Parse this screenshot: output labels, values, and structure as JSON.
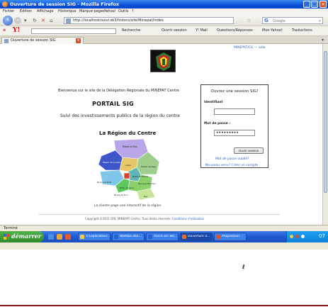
{
  "window": {
    "title": "Ouverture de session SIG - Mozilla Firefox",
    "minimize": "_",
    "maximize": "□",
    "close": "×"
  },
  "menu": [
    "Fichier",
    "Édition",
    "Affichage",
    "Historique",
    "Marque-pages",
    "Yahoo!",
    "Outils",
    "?"
  ],
  "nav": {
    "url": "http://localhost/suivi.sb3/htdocs/site/Minepat/index",
    "search_placeholder": "Google",
    "search_brand": "G"
  },
  "toolbar": {
    "yahoo": "Y!",
    "items": [
      "Recherche",
      "Ouvrir session",
      "Y! Mail",
      "Questions/Réponses",
      "Mon Yahoo!",
      "Traductions"
    ]
  },
  "tab": {
    "label": "Ouverture de session SIG",
    "close": "×"
  },
  "page": {
    "top_link": "MINEPAT/CG — aide",
    "welcome": "Bienvenue sur le site de la Délégation Régionale du MINEPAT Centre",
    "portal": "PORTAIL SIG",
    "subtitle": "Suivi des investissements publics de la région du centre",
    "region_title": "La Région du Centre",
    "map_labels": [
      "Mbam et Kim",
      "Mbam et Inoubou",
      "Haute Sanaga",
      "Lekié",
      "Mefou et Afamba",
      "Nyong et Kellé",
      "Nyong et So'o",
      "Nyong et Mfoumou",
      "Mefou et Akono",
      "Dja"
    ],
    "map_caption": "La cliente page une interactif de la région",
    "footer_text": "Copyright ©2011 DRC MINEPAT Centre. Tous droits réservés.",
    "footer_link": "Conditions d'utilisation"
  },
  "login": {
    "title": "Ouvrez une session SIG!",
    "id_label": "Identifiant",
    "id_value": "",
    "pw_label": "Mot de passe :",
    "pw_value": "•••••••••",
    "submit": "Ouvrir session",
    "forgot": "Mot de passe oublié?",
    "register": "Nouveau venu? Créer un compte"
  },
  "status": {
    "text": "Terminé"
  },
  "taskbar": {
    "start": "démarrer",
    "tasks": [
      "3 Explorateur...",
      "Wamba 4b1...",
      "micro arc wo...",
      "Ouverture d...",
      "Proposition..."
    ],
    "clock": "07"
  },
  "colors": {
    "titlebar": "#0a4fd6",
    "taskbar": "#1f58d1",
    "start": "#2f8a2b",
    "link": "#2d5fc4"
  }
}
